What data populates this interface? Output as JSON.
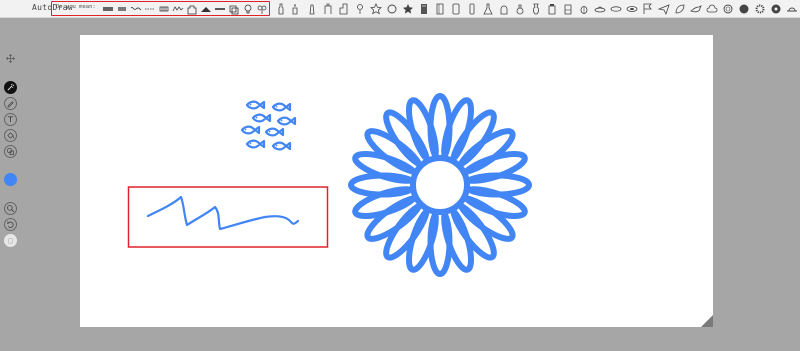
{
  "app": {
    "title": "AutoDraw"
  },
  "suggestions": {
    "prompt": "Do you mean:",
    "icons": [
      "wide-stripes-icon",
      "stripes-icon",
      "squiggle-icon",
      "dash-line-icon",
      "grille-icon",
      "zigzag-icon",
      "castle-icon",
      "mountain-icon",
      "long-bar-icon",
      "cube-icon",
      "lightbulb-icon",
      "bush-icon"
    ]
  },
  "library": {
    "icons": [
      "bottle-icon",
      "candle-icon",
      "lighthouse-icon",
      "tower-icon",
      "skyscraper-icon",
      "pin-icon",
      "star-outline-icon",
      "circle-outline-icon",
      "star-icon",
      "book-icon",
      "notebook-icon",
      "tablet-icon",
      "phone-icon",
      "flask-icon",
      "bell-jar-icon",
      "potion-icon",
      "vase-icon",
      "jar-icon",
      "beaker-icon",
      "bug-icon",
      "ufo-icon",
      "saucer-icon",
      "disc-icon",
      "flag-icon",
      "plane-icon",
      "leaf-icon",
      "bird-icon",
      "cloud-icon",
      "ring-icon",
      "cookie-icon",
      "gear-icon",
      "record-icon",
      "badge-icon",
      "hat-icon",
      "spider-icon"
    ]
  },
  "tools": [
    "move-tool-icon",
    "autodraw-tool-icon",
    "draw-tool-icon",
    "type-tool-icon",
    "fill-tool-icon",
    "shape-tool-icon",
    "color-swatch",
    "zoom-icon",
    "undo-icon",
    "delete-icon"
  ],
  "colors": {
    "stroke": "#4285f4",
    "highlight": "#e0202a",
    "active_tool": "#111111"
  }
}
